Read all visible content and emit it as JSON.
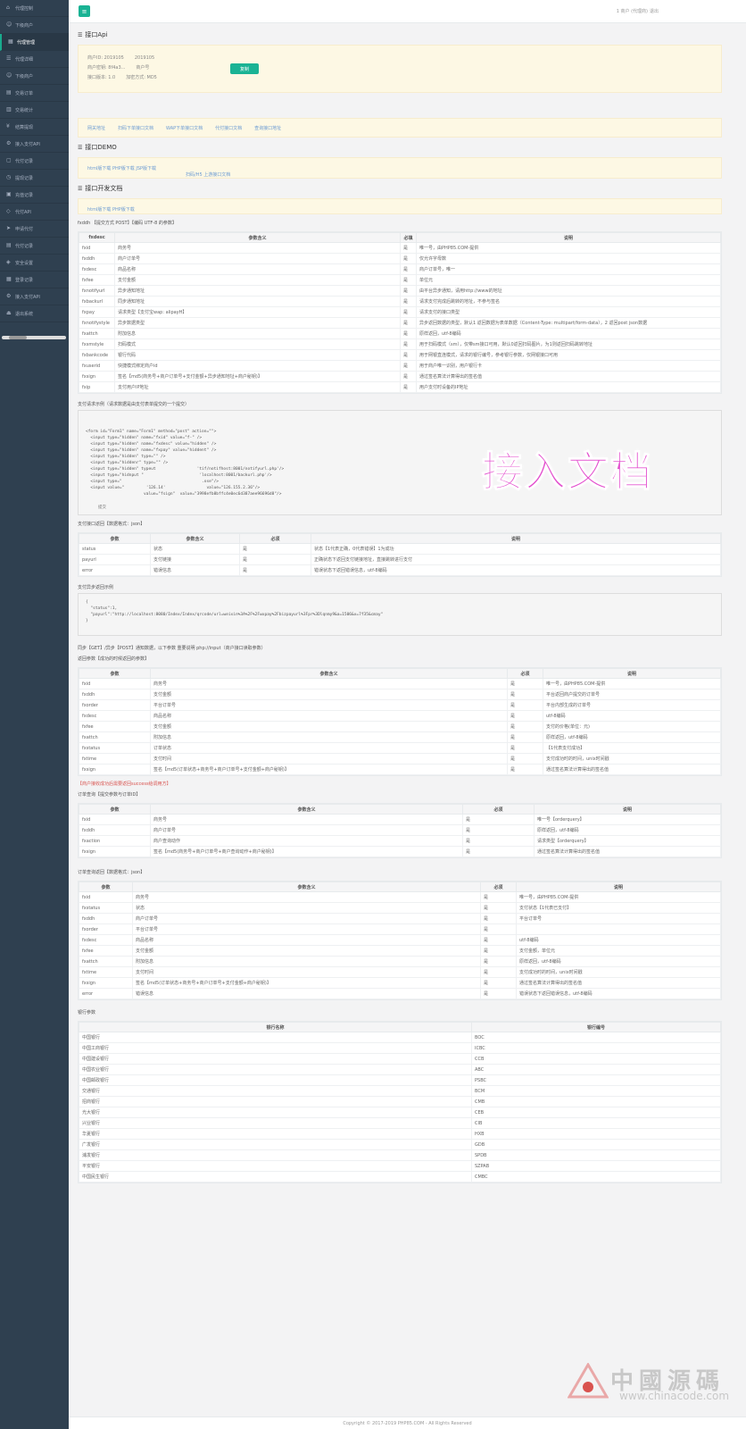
{
  "sidebar": {
    "items": [
      {
        "label": "代理控制",
        "icon": "home-icon"
      },
      {
        "label": "下级商户",
        "icon": "users-icon"
      },
      {
        "label": "代理管理",
        "icon": "grid-icon",
        "active": true
      },
      {
        "label": "代理详细",
        "icon": "list-icon"
      },
      {
        "label": "下级商户",
        "icon": "user-icon"
      },
      {
        "label": "交易订单",
        "icon": "chart-icon"
      },
      {
        "label": "交易统计",
        "icon": "bar-icon"
      },
      {
        "label": "结算提现",
        "icon": "money-icon"
      },
      {
        "label": "接入支付API",
        "icon": "plug-icon"
      },
      {
        "label": "代付记录",
        "icon": "file-icon"
      },
      {
        "label": "提现记录",
        "icon": "clock-icon"
      },
      {
        "label": "充值记录",
        "icon": "wallet-icon"
      },
      {
        "label": "代付API",
        "icon": "code-icon"
      },
      {
        "label": "申请代付",
        "icon": "send-icon"
      },
      {
        "label": "代付记录",
        "icon": "doc-icon"
      },
      {
        "label": "安全设置",
        "icon": "lock-icon"
      },
      {
        "label": "登录记录",
        "icon": "log-icon"
      },
      {
        "label": "接入支付API",
        "icon": "plug-icon"
      },
      {
        "label": "退出系统",
        "icon": "exit-icon"
      }
    ]
  },
  "topbar": {
    "menu_icon": "≡",
    "user": "1 商户 (代理商)",
    "exit": "退出"
  },
  "api": {
    "title": "接口Api",
    "row1": [
      "商户ID: 2019105",
      "2019105"
    ],
    "row2": [
      "商户密钥: 8f4a3...",
      "商户号"
    ],
    "row3": [
      "接口版本: 1.0",
      "加密方式: MD5"
    ],
    "button": "复制",
    "links": [
      "网关地址",
      "扫码下单接口文档",
      "WAP下单接口文档",
      "代付接口文档",
      "查询接口地址"
    ]
  },
  "demo": {
    "title": "接口DEMO",
    "line1": "html版下载 PHP版下载 JSP版下载",
    "line2": "扫码/H5 上游接口文档"
  },
  "doc": {
    "title": "接口开发文档",
    "line": "html版下载 PHP版下载",
    "intro": "fxddh 【提交方式 POST】【编码 UTF-8 的参数】",
    "param_headers": [
      "fxdesc",
      "参数含义",
      "必填",
      "说明"
    ],
    "params": [
      [
        "fxid",
        "商务号",
        "是",
        "唯一号，由PHP85.COM-提供"
      ],
      [
        "fxddh",
        "商户订单号",
        "是",
        "仅允许字母数"
      ],
      [
        "fxdesc",
        "商品名称",
        "是",
        "商户订单号，唯一"
      ],
      [
        "fxfee",
        "支付金额",
        "是",
        "单位元"
      ],
      [
        "fxnotifyurl",
        "异步通知地址",
        "是",
        "由平台异步通知，请用http://www的地址"
      ],
      [
        "fxbackurl",
        "同步通知地址",
        "是",
        "请求支付完成后跳转的地址，不参与签名"
      ],
      [
        "fxpay",
        "请求类型【支付宝wap: alipayH】",
        "是",
        "请求支付的接口类型"
      ],
      [
        "fxnotifystyle",
        "异步数据类型",
        "是",
        "异步返回数据的类型，默认1 返回数据为表单数据（Content-Type: multipart/form-data），2 返回post json数据"
      ],
      [
        "fxattch",
        "附加信息",
        "是",
        "原样返回，utf-8编码"
      ],
      [
        "fxsmstyle",
        "扫码模式",
        "是",
        "用于扫码模式（sm），仅带sm接口可用，默认0返回扫码图片，为1则返回扫码跳转地址"
      ],
      [
        "fxbankcode",
        "银行代码",
        "是",
        "用于网银直连模式，请求的银行编号，参考银行参数，仅网银接口可用"
      ],
      [
        "fxuserid",
        "快捷模式绑定商户id",
        "是",
        "用于商户唯一识别，用户银行卡"
      ],
      [
        "fxsign",
        "签名【md5(商务号+商户订单号+支付金额+异步通知地址+商户秘钥)】",
        "是",
        "通过签名算法计算得出的签名值"
      ],
      [
        "fxip",
        "支付用户IP地址",
        "是",
        "用户支付时设备的IP地址"
      ]
    ],
    "watermark": "接入文档",
    "example_title": "支付请求示例（请求数据是由支付表单提交的一个提交）",
    "code": "<form id=\"Form1\" name=\"Form1\" method=\"post\" action=\"\">\n  <input type=\"hidden\" name=\"fxid\" value=\"f-\" />\n  <input type=\"hidden\" name=\"fxdesc\" value=\"hidden\" />\n  <input type=\"hidden\" name=\"fxpay\" value=\"hiddent\" />\n  <input type=\"hidden\" type=\"\" />\n  <input type=\"hiddenr\" type=\"\" />\n  <input type=\"hidden\" typeut                 'tif/notifhost:8001/notifyurl.php'/>\n  <input type=\"hidnput \"                       'localhost:8001/backurl.php'/>\n  <input type=\"                                 .ose\"/>\n  <input value=\"         '126.14'                 value=\"126.155.2.36\"/>\n                        value=\"fsign\"  value=\"3998efb8bffc4e0ec6d387aee96696d8\"/>",
    "submit": "提交"
  },
  "return1": {
    "title": "支付接口返回【数据格式：json】",
    "headers": [
      "参数",
      "参数含义",
      "必须",
      "说明"
    ],
    "rows": [
      [
        "status",
        "状态",
        "是",
        "状态【1代表正确，0代表错误】1为成功"
      ],
      [
        "payurl",
        "支付链接",
        "是",
        "正确状态下返回支付链接地址，直接跳转进行支付"
      ],
      [
        "error",
        "错误信息",
        "是",
        "错误状态下返回错误信息，utf-8编码"
      ]
    ]
  },
  "return_example": {
    "title": "支付异步返回示例",
    "code": "{\n  \"status\":1,\n  \"payurl\":\"http://localhost:8080/Index/Index/qrcode/url=weixin%3A%2F%2Fwxpay%2Fbizpayurl%3Fpr%3Dlqnmy9&a=1506&x=7f35&cmay\"\n}"
  },
  "notify": {
    "title": "同步【GET】/异步【POST】通知数据，以下参数 重要说明 php://input（商户接口读取参数）",
    "sub": "返回参数【成功的时候返回的参数】",
    "headers": [
      "参数",
      "参数含义",
      "必须",
      "说明"
    ],
    "rows": [
      [
        "fxid",
        "商务号",
        "是",
        "唯一号，由PHP85.COM-提供"
      ],
      [
        "fxddh",
        "支付金额",
        "是",
        "平台返回商户提交的订单号"
      ],
      [
        "fxorder",
        "平台订单号",
        "是",
        "平台内部生成的订单号"
      ],
      [
        "fxdesc",
        "商品名称",
        "是",
        "utf-8编码"
      ],
      [
        "fxfee",
        "支付金额",
        "是",
        "支付的价格(单位：元)"
      ],
      [
        "fxattch",
        "附加信息",
        "是",
        "原样返回，utf-8编码"
      ],
      [
        "fxstatus",
        "订单状态",
        "是",
        "【1代表支付成功】"
      ],
      [
        "fxtime",
        "支付时间",
        "是",
        "支付成功时的时间，unix时间戳"
      ],
      [
        "fxsign",
        "签名【md5(订单状态+商务号+商户订单号+支付金额+商户秘钥)】",
        "是",
        "通过签名算法计算得出的签名值"
      ]
    ],
    "red_note": "【商户接收成功后需要返回success给调用方】",
    "trailing": "成功时的时间，unix时间戳"
  },
  "query": {
    "title": "订单查询【提交参数与订单ID】",
    "headers": [
      "参数",
      "参数含义",
      "必须",
      "说明"
    ],
    "rows": [
      [
        "fxid",
        "商务号",
        "是",
        "唯一号【orderquery】"
      ],
      [
        "fxddh",
        "商户订单号",
        "是",
        "原样返回，utf-8编码"
      ],
      [
        "fxaction",
        "商户查询动作",
        "是",
        "请求类型【orderquery】"
      ],
      [
        "fxsign",
        "签名【md5(商务号+商户订单号+商户查询动作+商户秘钥)】",
        "是",
        "通过签名算法计算得出的签名值"
      ]
    ]
  },
  "query_return": {
    "title": "订单查询返回【数据格式：json】",
    "headers": [
      "参数",
      "参数含义",
      "必须",
      "说明"
    ],
    "rows": [
      [
        "fxid",
        "商务号",
        "是",
        "唯一号，由PHP85.COM-提供"
      ],
      [
        "fxstatus",
        "状态",
        "是",
        "支付状态【1代表已支付】"
      ],
      [
        "fxddh",
        "商户订单号",
        "是",
        "平台订单号"
      ],
      [
        "fxorder",
        "平台订单号",
        "是",
        ""
      ],
      [
        "fxdesc",
        "商品名称",
        "是",
        "utf-8编码"
      ],
      [
        "fxfee",
        "支付金额",
        "是",
        "支付金额，单位元"
      ],
      [
        "fxattch",
        "附加信息",
        "是",
        "原样返回，utf-8编码"
      ],
      [
        "fxtime",
        "支付时间",
        "是",
        "支付成功时的时间，unix时间戳"
      ],
      [
        "fxsign",
        "签名【md5(订单状态+商务号+商户订单号+支付金额+商户秘钥)】",
        "是",
        "通过签名算法计算得出的签名值"
      ],
      [
        "error",
        "错误信息",
        "是",
        "错误状态下返回错误信息，utf-8编码"
      ]
    ]
  },
  "banks": {
    "title": "银行参数",
    "headers": [
      "银行名称",
      "银行编号"
    ],
    "rows": [
      [
        "中国银行",
        "BOC"
      ],
      [
        "中国工商银行",
        "ICBC"
      ],
      [
        "中国建设银行",
        "CCB"
      ],
      [
        "中国农业银行",
        "ABC"
      ],
      [
        "中国邮政银行",
        "PSBC"
      ],
      [
        "交通银行",
        "BCM"
      ],
      [
        "招商银行",
        "CMB"
      ],
      [
        "光大银行",
        "CEB"
      ],
      [
        "兴业银行",
        "CIB"
      ],
      [
        "华夏银行",
        "HXB"
      ],
      [
        "广发银行",
        "GDB"
      ],
      [
        "浦发银行",
        "SPDB"
      ],
      [
        "平安银行",
        "SZPAB"
      ],
      [
        "中国民生银行",
        "CMBC"
      ]
    ]
  },
  "footer": "Copyright © 2017-2019 PHP85.COM - All Rights Reserved",
  "logo": {
    "brand": "中國源碼",
    "url": "www.chinacode.com"
  }
}
